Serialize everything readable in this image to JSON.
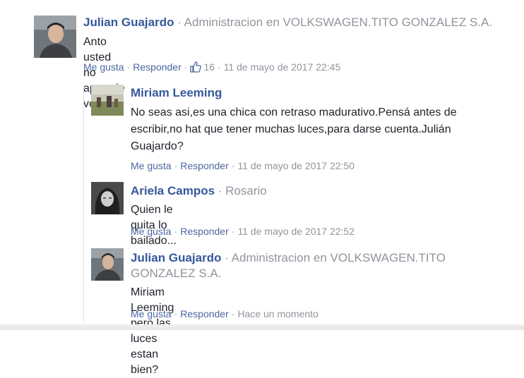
{
  "comments": [
    {
      "author": "Julian Guajardo",
      "subtitle": "· Administracion en VOLKSWAGEN.TITO GONZALEZ S.A.",
      "text": "Anto usted no aprende verdad?",
      "like_label": "Me gusta",
      "reply_label": "Responder",
      "likes": "16",
      "time": "11 de mayo de 2017 22:45"
    }
  ],
  "replies": [
    {
      "author": "Miriam Leeming",
      "subtitle": "",
      "text": "No seas asi,es una chica con retraso madurativo.Pensá antes de escribir,no hat que tener muchas luces,para darse cuenta.Julián Guajardo?",
      "like_label": "Me gusta",
      "reply_label": "Responder",
      "time": "11 de mayo de 2017 22:50"
    },
    {
      "author": "Ariela Campos",
      "subtitle": "· Rosario",
      "text": "Quien le quita lo bailado...",
      "like_label": "Me gusta",
      "reply_label": "Responder",
      "time": "11 de mayo de 2017 22:52"
    },
    {
      "author": "Julian Guajardo",
      "subtitle": "· Administracion en VOLKSWAGEN.TITO GONZALEZ S.A.",
      "text": "Miriam Leeming pero las luces estan bien?",
      "like_label": "Me gusta",
      "reply_label": "Responder",
      "time": "Hace un momento"
    }
  ],
  "icons": {
    "like": "thumbs-up-icon",
    "avatar": "profile-photo"
  },
  "colors": {
    "author_link": "#365899",
    "action_link": "#4b67a1",
    "meta": "#90949c",
    "text": "#1d2129"
  }
}
